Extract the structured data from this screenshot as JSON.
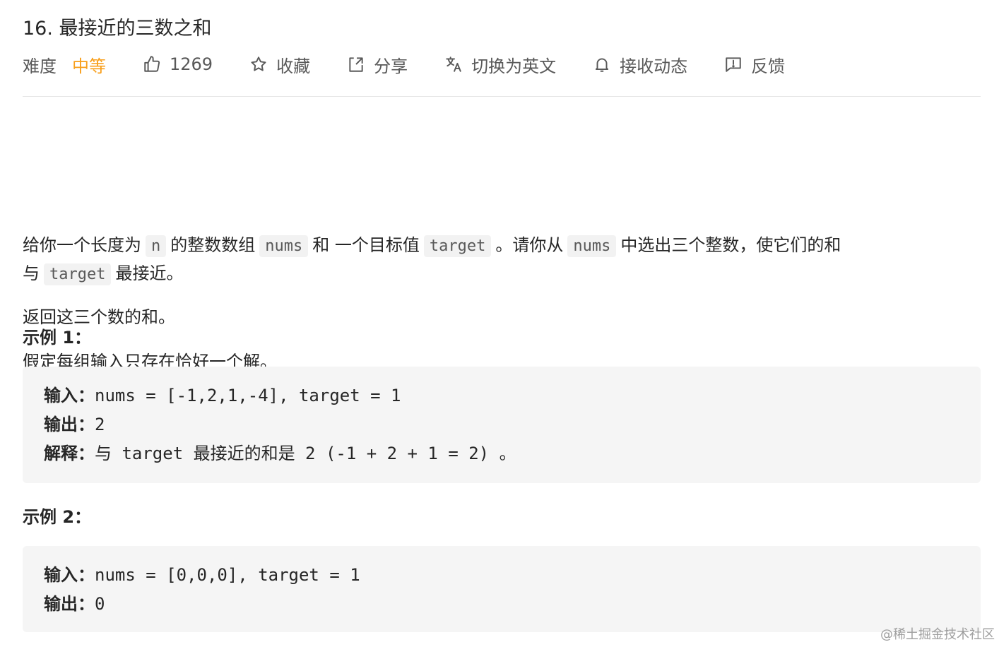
{
  "problem": {
    "title": "16. 最接近的三数之和"
  },
  "toolbar": {
    "difficulty_label": "难度",
    "difficulty_value": "中等",
    "likes": "1269",
    "favorite_label": "收藏",
    "share_label": "分享",
    "switch_lang_label": "切换为英文",
    "notify_label": "接收动态",
    "feedback_label": "反馈"
  },
  "description": {
    "p1_a": "给你一个长度为",
    "p1_code_n": "n",
    "p1_b": "的整数数组",
    "p1_code_nums": "nums",
    "p1_c": "和 一个目标值",
    "p1_code_target": "target",
    "p1_d": "。请你从",
    "p1_code_nums2": "nums",
    "p1_e": "中选出三个整数，使它们的和",
    "p1_f": "与",
    "p1_code_target2": "target",
    "p1_g": "最接近。",
    "p2": "返回这三个数的和。",
    "p3": "假定每组输入只存在恰好一个解。"
  },
  "examples": [
    {
      "title": "示例 1：",
      "input_label": "输入：",
      "input_value": "nums = [-1,2,1,-4], target = 1",
      "output_label": "输出：",
      "output_value": "2",
      "explain_label": "解释：",
      "explain_value": "与 target 最接近的和是 2 (-1 + 2 + 1 = 2) 。"
    },
    {
      "title": "示例 2：",
      "input_label": "输入：",
      "input_value": "nums = [0,0,0], target = 1",
      "output_label": "输出：",
      "output_value": "0"
    }
  ],
  "watermark": "@稀土掘金技术社区",
  "colors": {
    "difficulty_medium": "#f89f1b",
    "code_bg": "#f5f5f5",
    "divider": "#e5e5e5"
  },
  "icons": [
    "thumbs-up-icon",
    "star-icon",
    "share-icon",
    "translate-icon",
    "bell-icon",
    "feedback-icon"
  ]
}
